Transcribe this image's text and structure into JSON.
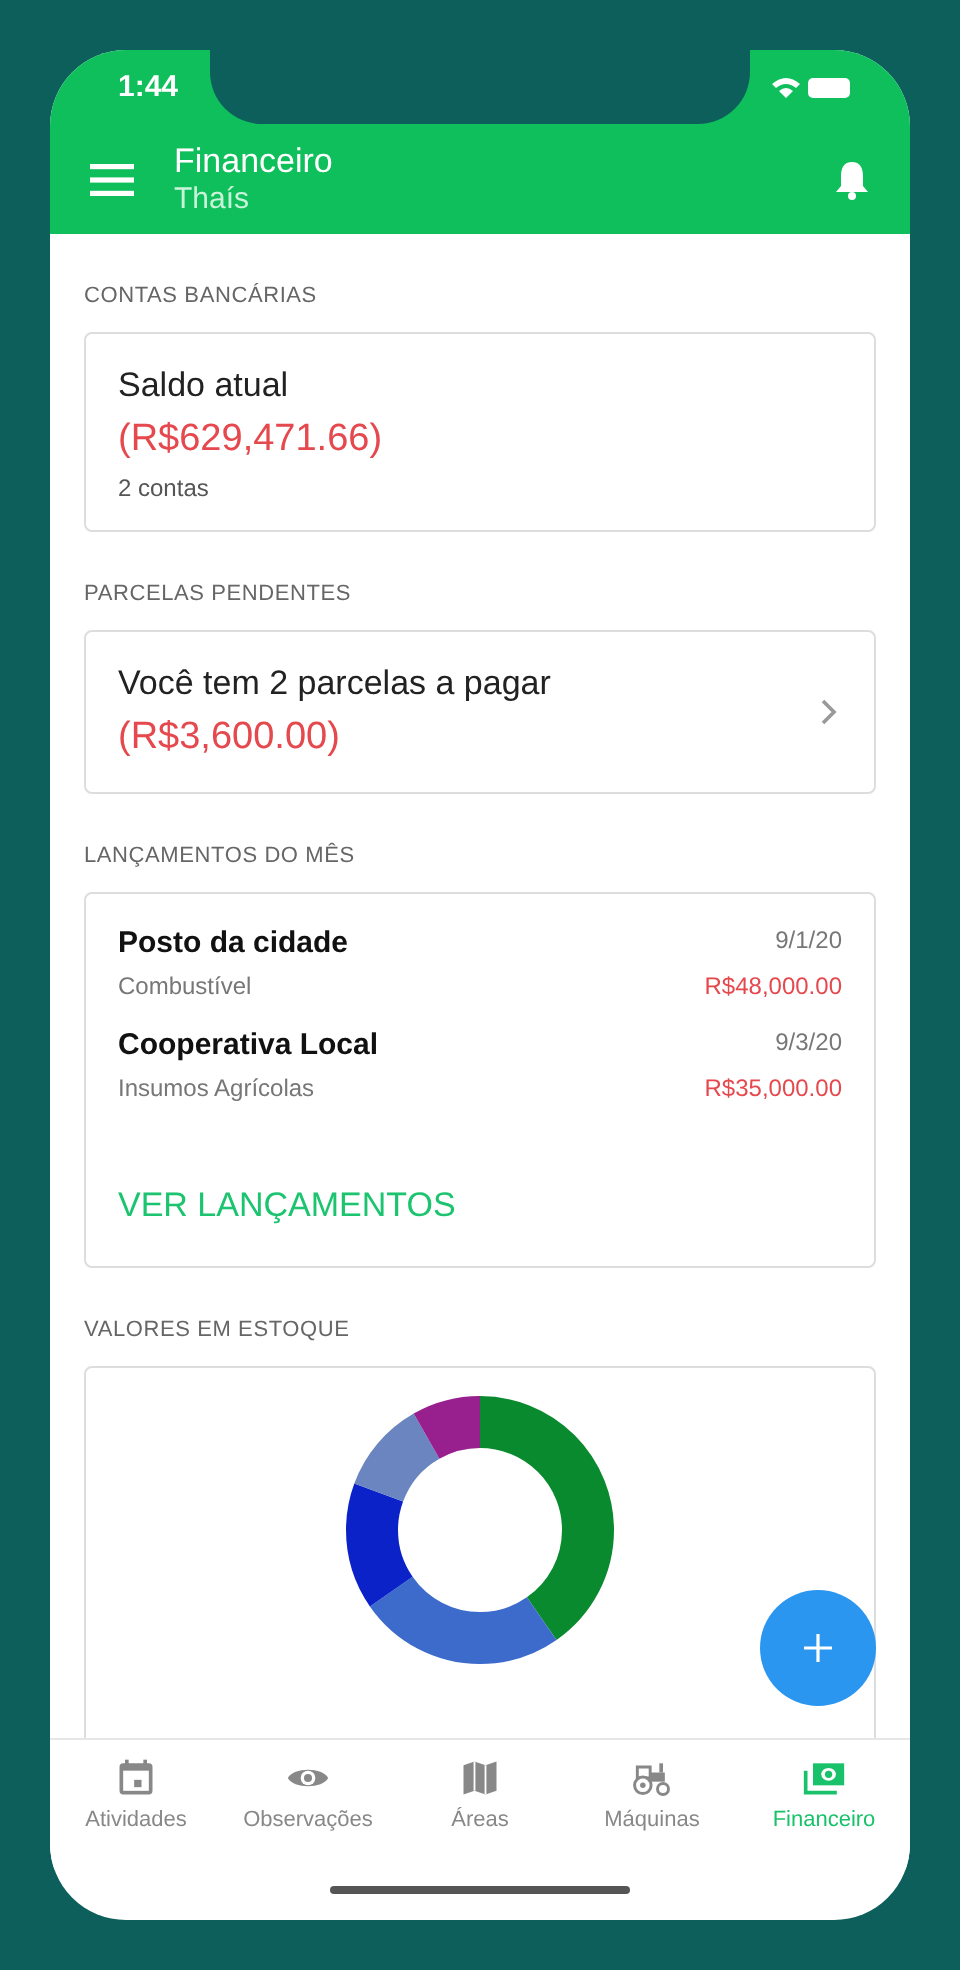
{
  "status_bar": {
    "time": "1:44"
  },
  "header": {
    "title": "Financeiro",
    "subtitle": "Thaís"
  },
  "accounts": {
    "label": "CONTAS BANCÁRIAS",
    "title": "Saldo atual",
    "amount": "(R$629,471.66)",
    "count": "2 contas"
  },
  "pending": {
    "label": "PARCELAS PENDENTES",
    "text": "Você tem 2 parcelas a pagar",
    "amount": "(R$3,600.00)"
  },
  "transactions": {
    "label": "LANÇAMENTOS DO MÊS",
    "items": [
      {
        "name": "Posto da cidade",
        "category": "Combustível",
        "date": "9/1/20",
        "amount": "R$48,000.00"
      },
      {
        "name": "Cooperativa Local",
        "category": "Insumos Agrícolas",
        "date": "9/3/20",
        "amount": "R$35,000.00"
      }
    ],
    "link": "VER LANÇAMENTOS"
  },
  "stock": {
    "label": "VALORES EM ESTOQUE"
  },
  "tabs": [
    {
      "kind": "calendar",
      "label": "Atividades",
      "selected": false
    },
    {
      "kind": "eye",
      "label": "Observações",
      "selected": false
    },
    {
      "kind": "map",
      "label": "Áreas",
      "selected": false
    },
    {
      "kind": "tractor",
      "label": "Máquinas",
      "selected": false
    },
    {
      "kind": "money",
      "label": "Financeiro",
      "selected": true
    }
  ]
}
